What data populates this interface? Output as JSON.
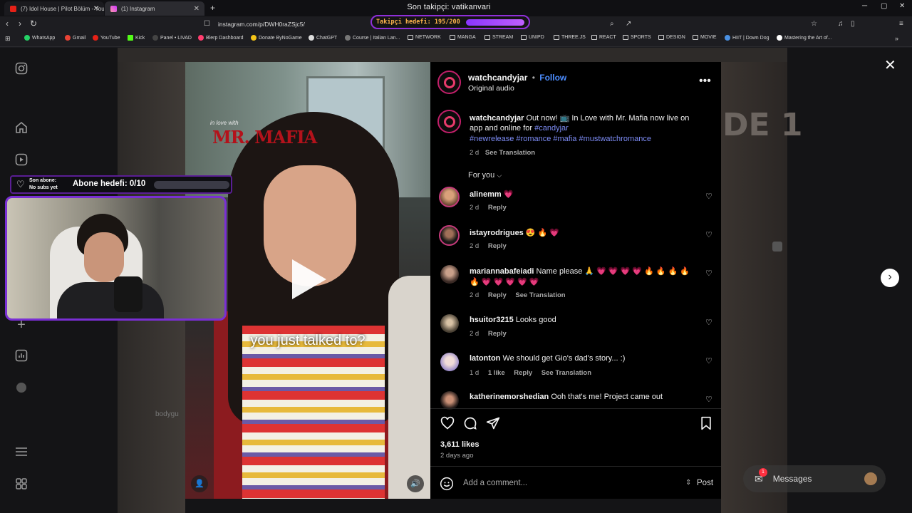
{
  "browser": {
    "window_title": "Son takipçi: vatikanvari",
    "tabs": [
      {
        "label": "(7) Idol House | Pilot Bölüm - YouTube",
        "active": false
      },
      {
        "label": "(1) Instagram",
        "active": true
      }
    ],
    "url": "instagram.com/p/DWH0raZSjc5/",
    "bookmarks": [
      "WhatsApp",
      "Gmail",
      "YouTube",
      "Kick",
      "Panel • LIVAD",
      "Blerp Dashboard",
      "Donate ByNoGame",
      "ChatGPT",
      "Course | Italian Lan...",
      "NETWORK",
      "MANGA",
      "STREAM",
      "UNIPD",
      "THREE.JS",
      "REACT",
      "SPORTS",
      "DESIGN",
      "MOVIE",
      "HIIT | Down Dog",
      "Mastering the Art of..."
    ]
  },
  "overlays": {
    "follow_goal_text": "Takipçi hedefi: 195/200",
    "follow_goal_progress": 0.975,
    "sub_label_top": "Son abone:",
    "sub_label_bottom": "No subs yet",
    "sub_goal_text": "Abone hedefi: 0/10",
    "sub_goal_progress": 0
  },
  "video": {
    "caption": "you just talked to?",
    "watermark_small": "in love with",
    "watermark_big": "MR. MAFIA",
    "background_text": "DE 1",
    "side_text": "bodygu"
  },
  "post": {
    "username": "watchcandyjar",
    "separator": "•",
    "follow_label": "Follow",
    "audio": "Original audio",
    "caption_user": "watchcandyjar",
    "caption_line1": "Out now! 📺 In Love with Mr. Mafia now live on",
    "caption_line2_text": "app and online for ",
    "caption_line2_tag": "#candyjar",
    "caption_line3": "#newrelease #romance #mafia #mustwatchromance",
    "caption_age": "2 d",
    "see_translation": "See Translation",
    "sort_label": "For you",
    "likes": "3,611 likes",
    "posted": "2 days ago",
    "comment_placeholder": "Add a comment...",
    "post_button": "Post"
  },
  "comments": [
    {
      "user": "alinemm",
      "text": "💗",
      "age": "2 d",
      "likes": "",
      "reply": "Reply",
      "translate": ""
    },
    {
      "user": "istayrodrigues",
      "text": "😍 🔥 💗",
      "age": "2 d",
      "likes": "",
      "reply": "Reply",
      "translate": ""
    },
    {
      "user": "mariannabafeiadi",
      "text": "Name please 🙏 💗 💗 💗 💗 🔥 🔥 🔥 🔥",
      "text2": "🔥 💗 💗 💗 💗 💗",
      "age": "2 d",
      "likes": "",
      "reply": "Reply",
      "translate": "See Translation"
    },
    {
      "user": "hsuitor3215",
      "text": "Looks good",
      "age": "2 d",
      "likes": "",
      "reply": "Reply",
      "translate": ""
    },
    {
      "user": "latonton",
      "text": "We should get Gio's dad's story... :)",
      "age": "1 d",
      "likes": "1 like",
      "reply": "Reply",
      "translate": "See Translation"
    },
    {
      "user": "katherinemorshedian",
      "text": "Ooh that's me! Project came out",
      "age": "",
      "likes": "",
      "reply": "",
      "translate": ""
    }
  ],
  "messages": {
    "label": "Messages",
    "badge": "1"
  },
  "icons": [
    "instagram-icon",
    "home-icon",
    "reels-icon",
    "plus-icon",
    "stats-icon",
    "menu-icon",
    "grid-icon",
    "close-icon",
    "next-arrow-icon",
    "play-icon",
    "heart-icon",
    "comment-icon",
    "share-icon",
    "bookmark-icon",
    "emoji-icon",
    "more-icon",
    "volume-icon",
    "user-icon"
  ]
}
